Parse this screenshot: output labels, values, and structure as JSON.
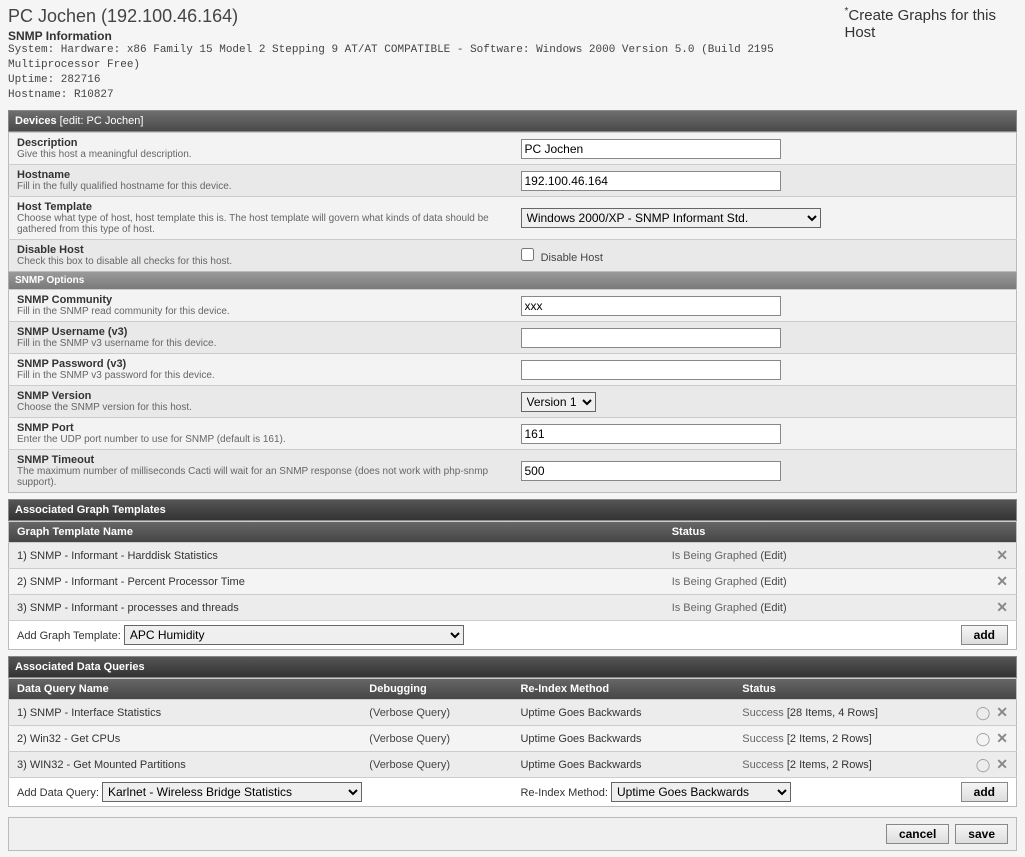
{
  "header": {
    "title": "PC Jochen (192.100.46.164)",
    "snmp_info_label": "SNMP Information",
    "system_line": "System: Hardware: x86 Family 15 Model 2 Stepping 9 AT/AT COMPATIBLE - Software: Windows 2000 Version 5.0 (Build 2195 Multiprocessor Free)",
    "uptime_line": "Uptime: 282716",
    "hostname_line": "Hostname: R10827",
    "create_link_pre": "*",
    "create_link": "Create Graphs for this Host"
  },
  "devices": {
    "section_title": "Devices",
    "edit_label": "[edit: PC Jochen]",
    "fields": {
      "description": {
        "name": "Description",
        "desc": "Give this host a meaningful description.",
        "value": "PC Jochen"
      },
      "hostname": {
        "name": "Hostname",
        "desc": "Fill in the fully qualified hostname for this device.",
        "value": "192.100.46.164"
      },
      "host_template": {
        "name": "Host Template",
        "desc": "Choose what type of host, host template this is. The host template will govern what kinds of data should be gathered from this type of host.",
        "value": "Windows 2000/XP - SNMP Informant Std."
      },
      "disable_host": {
        "name": "Disable Host",
        "desc": "Check this box to disable all checks for this host.",
        "checkbox_label": "Disable Host"
      }
    },
    "snmp_options_label": "SNMP Options",
    "snmp": {
      "community": {
        "name": "SNMP Community",
        "desc": "Fill in the SNMP read community for this device.",
        "value": "xxx"
      },
      "username": {
        "name": "SNMP Username (v3)",
        "desc": "Fill in the SNMP v3 username for this device.",
        "value": ""
      },
      "password": {
        "name": "SNMP Password (v3)",
        "desc": "Fill in the SNMP v3 password for this device.",
        "value": ""
      },
      "version": {
        "name": "SNMP Version",
        "desc": "Choose the SNMP version for this host.",
        "value": "Version 1"
      },
      "port": {
        "name": "SNMP Port",
        "desc": "Enter the UDP port number to use for SNMP (default is 161).",
        "value": "161"
      },
      "timeout": {
        "name": "SNMP Timeout",
        "desc": "The maximum number of milliseconds Cacti will wait for an SNMP response (does not work with php-snmp support).",
        "value": "500"
      }
    }
  },
  "graph_templates": {
    "title": "Associated Graph Templates",
    "col_name": "Graph Template Name",
    "col_status": "Status",
    "rows": [
      {
        "num": "1)",
        "name": "SNMP - Informant - Harddisk Statistics",
        "status": "Is Being Graphed",
        "edit": "(Edit)"
      },
      {
        "num": "2)",
        "name": "SNMP - Informant - Percent Processor Time",
        "status": "Is Being Graphed",
        "edit": "(Edit)"
      },
      {
        "num": "3)",
        "name": "SNMP - Informant - processes and threads",
        "status": "Is Being Graphed",
        "edit": "(Edit)"
      }
    ],
    "add_label": "Add Graph Template:",
    "add_select": "APC Humidity",
    "add_button": "add"
  },
  "data_queries": {
    "title": "Associated Data Queries",
    "col_name": "Data Query Name",
    "col_debug": "Debugging",
    "col_reindex": "Re-Index Method",
    "col_status": "Status",
    "rows": [
      {
        "num": "1)",
        "name": "SNMP - Interface Statistics",
        "debug": "(Verbose Query)",
        "reindex": "Uptime Goes Backwards",
        "status_prefix": "Success",
        "status_detail": "[28 Items, 4 Rows]"
      },
      {
        "num": "2)",
        "name": "Win32 - Get CPUs",
        "debug": "(Verbose Query)",
        "reindex": "Uptime Goes Backwards",
        "status_prefix": "Success",
        "status_detail": "[2 Items, 2 Rows]"
      },
      {
        "num": "3)",
        "name": "WIN32 - Get Mounted Partitions",
        "debug": "(Verbose Query)",
        "reindex": "Uptime Goes Backwards",
        "status_prefix": "Success",
        "status_detail": "[2 Items, 2 Rows]"
      }
    ],
    "add_label": "Add Data Query:",
    "add_select": "Karlnet - Wireless Bridge Statistics",
    "reindex_label": "Re-Index Method:",
    "reindex_select": "Uptime Goes Backwards",
    "add_button": "add"
  },
  "footer": {
    "cancel": "cancel",
    "save": "save"
  }
}
